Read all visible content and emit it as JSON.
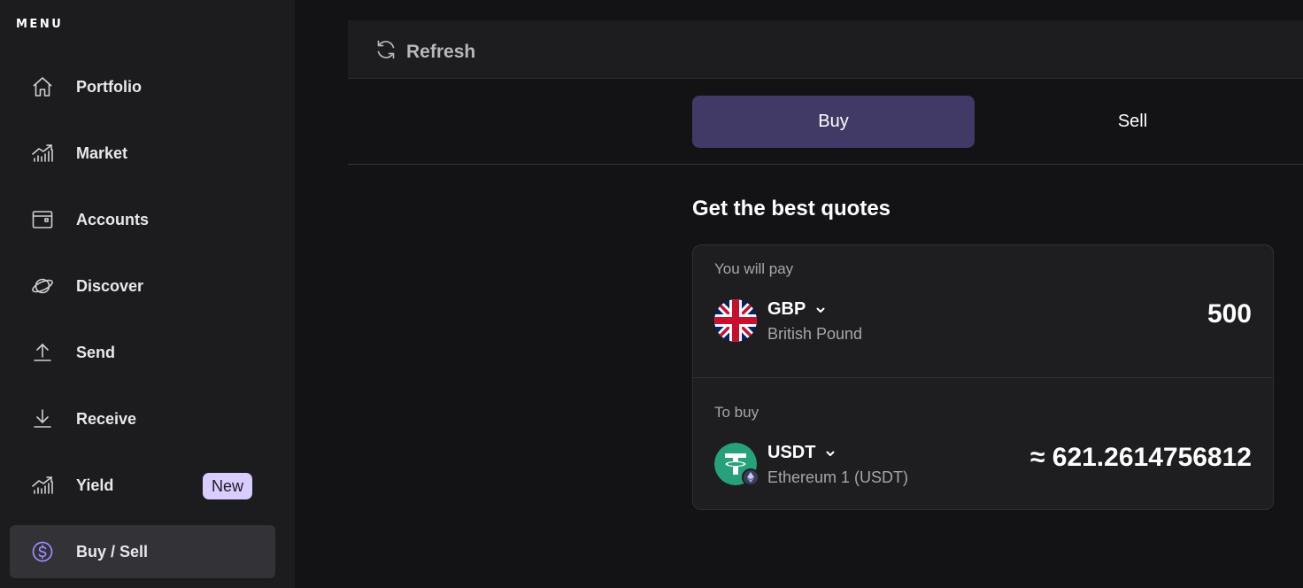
{
  "sidebar": {
    "title": "MENU",
    "items": [
      {
        "label": "Portfolio",
        "icon": "home-icon"
      },
      {
        "label": "Market",
        "icon": "chart-icon"
      },
      {
        "label": "Accounts",
        "icon": "wallet-icon"
      },
      {
        "label": "Discover",
        "icon": "planet-icon"
      },
      {
        "label": "Send",
        "icon": "upload-icon"
      },
      {
        "label": "Receive",
        "icon": "download-icon"
      },
      {
        "label": "Yield",
        "icon": "chart-icon",
        "badge": "New"
      },
      {
        "label": "Buy / Sell",
        "icon": "dollar-circle-icon",
        "active": true
      }
    ]
  },
  "topbar": {
    "refresh_label": "Refresh"
  },
  "tabs": {
    "buy": "Buy",
    "sell": "Sell",
    "active": "buy"
  },
  "main": {
    "title": "Get the best quotes",
    "pay": {
      "label": "You will pay",
      "currency_code": "GBP",
      "currency_name": "British Pound",
      "amount": "500",
      "icon": "uk-flag-icon"
    },
    "buy": {
      "label": "To buy",
      "currency_code": "USDT",
      "currency_name": "Ethereum 1 (USDT)",
      "amount": "≈ 621.2614756812",
      "icon": "tether-icon",
      "network_icon": "ethereum-icon"
    }
  },
  "colors": {
    "accent": "#413a66",
    "badge": "#d9ccff",
    "tether": "#26a17b",
    "active_icon": "#9c8cff"
  }
}
